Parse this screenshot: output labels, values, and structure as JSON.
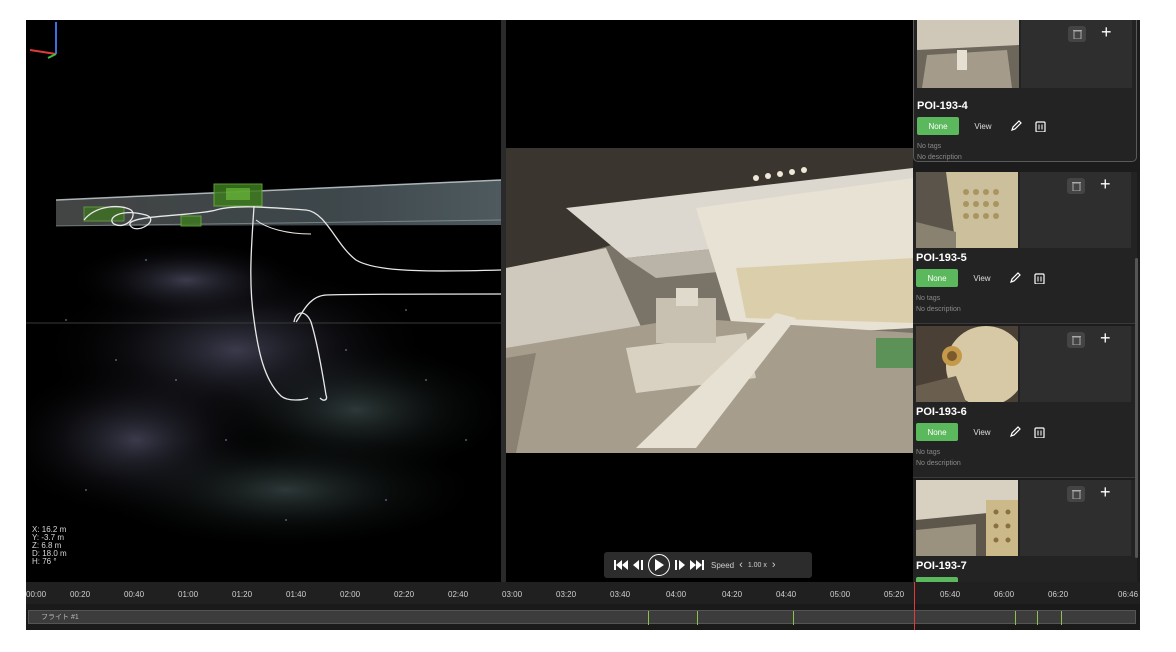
{
  "coords": {
    "x": "X:  16.2 m",
    "y": "Y:   -3.7 m",
    "z": "Z:    6.8 m",
    "d": "D: 18.0 m",
    "h": "H:      76 °"
  },
  "player": {
    "speed_label": "Speed",
    "speed_value": "1.00 x",
    "speed_prev": "‹",
    "speed_next": "›"
  },
  "poi": {
    "none_label": "None",
    "view_label": "View",
    "no_tags": "No tags",
    "no_description": "No description",
    "plus": "+",
    "items": [
      {
        "title": "POI-193-4"
      },
      {
        "title": "POI-193-5"
      },
      {
        "title": "POI-193-6"
      },
      {
        "title": "POI-193-7"
      }
    ]
  },
  "timeline": {
    "ticks": [
      "00:00",
      "00:20",
      "00:40",
      "01:00",
      "01:20",
      "01:40",
      "02:00",
      "02:20",
      "02:40",
      "03:00",
      "03:20",
      "03:40",
      "04:00",
      "04:20",
      "04:40",
      "05:00",
      "05:20",
      "05:40",
      "06:00",
      "06:20",
      "06:46"
    ],
    "track_label": "フライト #1"
  },
  "colors": {
    "accent_green": "#5cb85c",
    "playhead_red": "#e53935",
    "path_green": "#6ab83a"
  },
  "icons": [
    "skip-back-icon",
    "step-back-icon",
    "play-icon",
    "step-forward-icon",
    "skip-forward-icon",
    "trash-icon",
    "pencil-icon",
    "plus-icon"
  ]
}
